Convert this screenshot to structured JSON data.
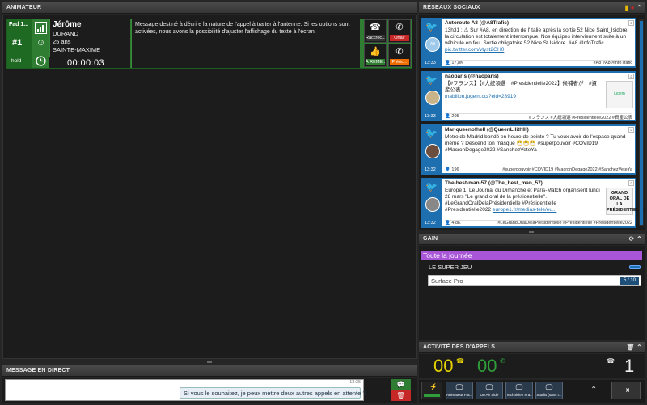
{
  "colors": {
    "accent": "#1e6fb0",
    "call_green": "#2e7d32",
    "gain_purple": "#a855d8",
    "counter_yellow": "#e6d200",
    "counter_green": "#2e9d3a"
  },
  "animateur": {
    "title": "ANIMATEUR",
    "call": {
      "queue_label": "Fad 1...",
      "position": "#1",
      "hold_label": "hold",
      "name": "Jérôme",
      "lastname": "DURAND",
      "age": "25 ans",
      "city": "SAINTE-MAXIME",
      "timer": "00:00:03",
      "message": "Message destiné à décrire la nature de l'appel à traiter à l'antenne. Si les options sont activées,  nous avons la possibilité d'ajuster l'affichage du texte à l'écran.",
      "actions": [
        {
          "label": "Raccroc...",
          "icon": "hangup-icon"
        },
        {
          "label": "Onair",
          "icon": "phone-onair-icon"
        },
        {
          "label": "À REME...",
          "icon": "thumbs-up-icon"
        },
        {
          "label": "Prééc...",
          "icon": "phone-transfer-icon"
        }
      ]
    }
  },
  "message_direct": {
    "title": "MESSAGE EN DIRECT",
    "timestamp": "13:35",
    "bubble_text": "Si vous le souhaitez, je peux mettre deux autres appels en attente ?"
  },
  "social": {
    "title": "RÉSEAUX SOCIAUX",
    "tweets": [
      {
        "handle": "Autoroute A8 (@A8Trafic)",
        "text": "13h31 : ⚠ Sur #A8, en direction de l'Italie après la sortie 52 Nice Saint_Isidore, la circulation est totalement interrompue. Nos équipes interviennent suite à un véhicule en feu. Sortie obligatoire 52 Nice St Isidore. #A8 #InfoTrafic",
        "link": "pic.twitter.com/vtyst2GH0",
        "count": "17,8K",
        "tags": "#A8 #A8 #InfoTrafic",
        "time": "13:33",
        "avatar": "A8"
      },
      {
        "handle": "naoparis (@naoparis)",
        "text": "【#フランス】【#大統領選　#Presidentielle2022】候補者が　#資産公表",
        "link": "mabillon.jugem.cc/?eid=28919",
        "count": "205",
        "tags": "#フランス #大統領選 #Presidentielle2022 #資産公表",
        "time": "13:33",
        "avatar": "",
        "thumb": "jugem"
      },
      {
        "handle": "Mar-queenofhell (@QueenLilithIII)",
        "text": "Metro de Madrid bondé en heure de pointe ? Tu veux avoir de l'espace quand même ? Descend ton masque 😷😷😷 #superpouvoir #COVID19 #MacronDegage2022 #SanchezVeteYa",
        "link": "",
        "count": "196",
        "tags": "#superpouvoir #COVID19 #MacronDegage2022 #SanchezVeteYa",
        "time": "13:32",
        "avatar": ""
      },
      {
        "handle": "The-best-man-57 (@The_best_man_57)",
        "text": "Europe 1, Le Journal du Dimanche et Paris-Match organisent lundi 28 mars \"Le grand oral de la présidentielle\". #LeGrandOralDelaPrésidentielle #Présidentielle #Presidentielle2022",
        "link": "europe1.fr/medias-tele/eu...",
        "count": "4,8K",
        "tags": "#LeGrandOralDelaPrésidentielle #Présidentielle #Presidentielle2022",
        "time": "13:32",
        "avatar": "",
        "thumb": "GRAND ORAL DE LA PRÉSIDENTIELLE"
      }
    ]
  },
  "gain": {
    "title": "GAIN",
    "period": "Toute la journée",
    "lot": "LE SUPER JEU",
    "item": "Surface Pro",
    "item_count": "5 / 10"
  },
  "activite": {
    "title": "ACTIVITÉ DES D'APPELS",
    "waiting": "00",
    "onair": "00",
    "total": "1"
  },
  "bottom_buttons": [
    {
      "label": "Animateur Fra..."
    },
    {
      "label": "On Air Side"
    },
    {
      "label": "Technicien Fra..."
    },
    {
      "label": "Studio (sans r..."
    }
  ]
}
